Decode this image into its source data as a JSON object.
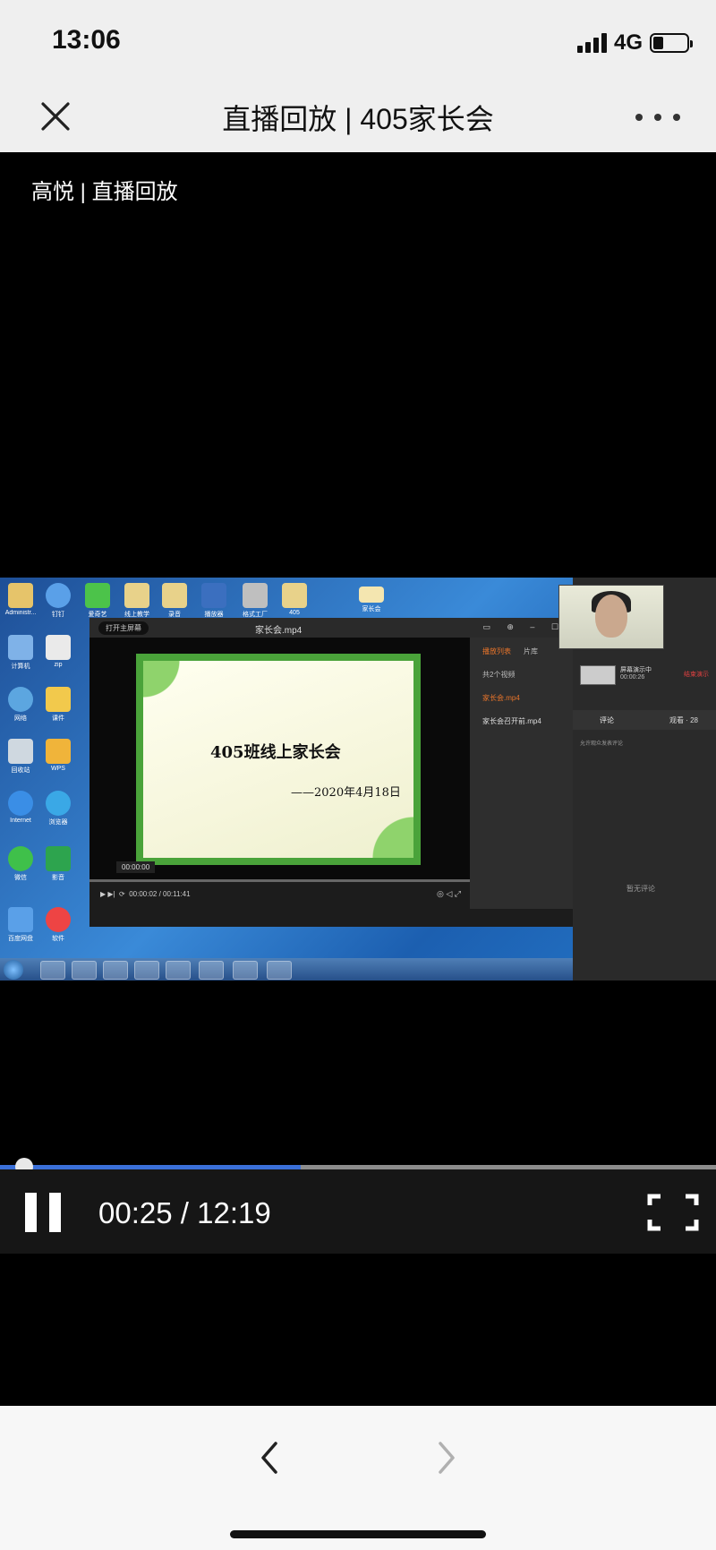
{
  "status_bar": {
    "time": "13:06",
    "network": "4G",
    "battery_level": 0.3
  },
  "nav": {
    "title": "直播回放 | 405家长会"
  },
  "video": {
    "caption": "高悦 | 直播回放",
    "frame": {
      "player_file": "家长会.mp4",
      "open_home_label": "打开主屏幕",
      "slide_title": "405班线上家长会",
      "slide_date": "——2020年4月18日",
      "time_chip": "00:00:00",
      "inner_time": "00:00:02 / 00:11:41",
      "playlist_tab": "播放列表",
      "library_tab": "片库",
      "video_count": "共2个视频",
      "playlist_items": [
        "家长会.mp4",
        "家长会召开前.mp4"
      ],
      "live_status": "屏幕演示中",
      "live_time": "00:00:26",
      "stop_label": "结束演示",
      "comments_tab": "评论",
      "viewers_tab": "观看 · 28",
      "comment_hint": "允许观众发表评论",
      "no_comments": "暂无评论"
    }
  },
  "player": {
    "current_time": "00:25",
    "separator": " / ",
    "duration": "12:19",
    "buffered_fraction": 0.42
  },
  "icons": [
    "close-icon",
    "more-icon",
    "pause-icon",
    "fullscreen-icon",
    "back-icon",
    "forward-icon"
  ]
}
